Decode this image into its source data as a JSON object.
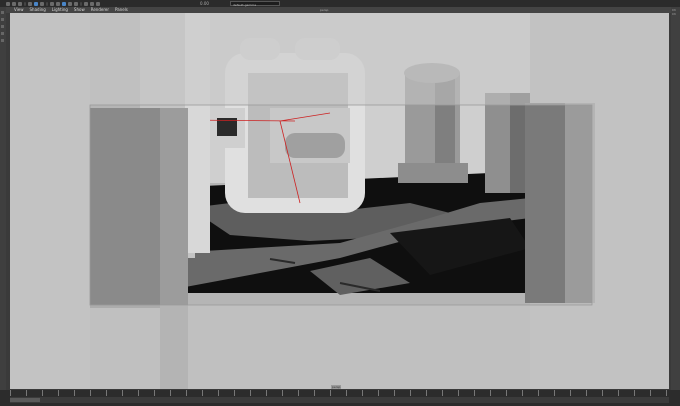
{
  "window": {
    "title": "persp",
    "right_panel_text": "Ch\nCh"
  },
  "menu": {
    "items": [
      "View",
      "Shading",
      "Lighting",
      "Show",
      "Renderer",
      "Panels"
    ]
  },
  "toolbar": {
    "coord_value": "0.00",
    "camera_field": "default-gamma"
  },
  "viewport": {
    "camera_label": "persp",
    "frame_label": "persp"
  },
  "timeline": {
    "marker": "1"
  },
  "colors": {
    "ui_dark": "#2b2b2b",
    "ui_panel": "#444444",
    "accent": "#4a86c8",
    "viewport_bg": "#b8b8b8",
    "floor_dark": "#111111"
  },
  "icons": [
    "select-icon",
    "move-icon",
    "rotate-icon",
    "scale-icon",
    "camera-icon",
    "grid-icon",
    "shading-icon",
    "light-icon",
    "axis-icon"
  ]
}
